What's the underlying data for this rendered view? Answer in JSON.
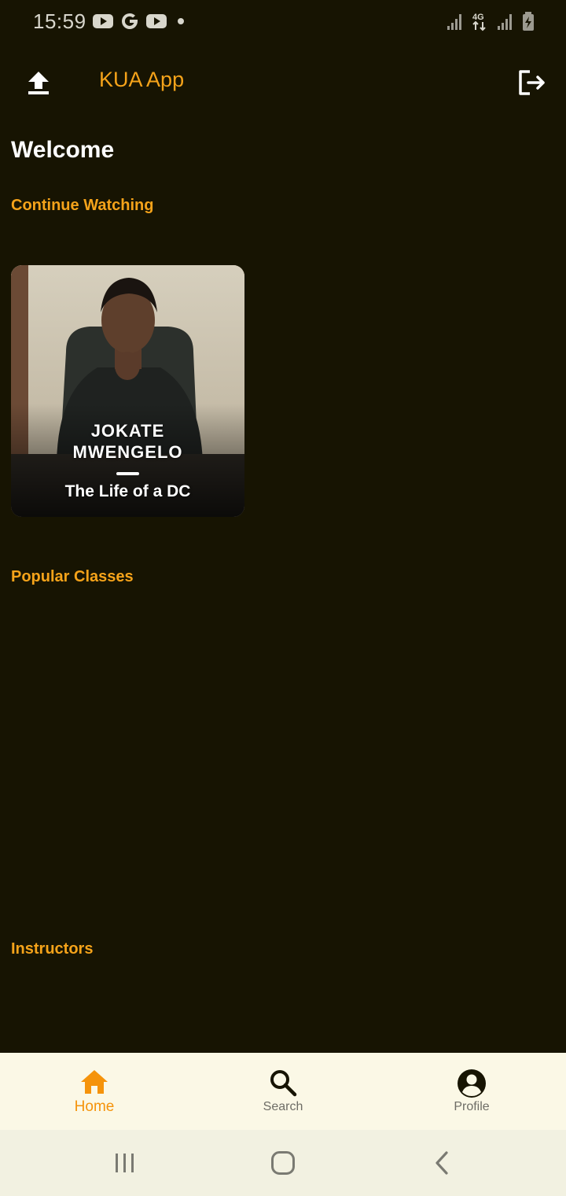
{
  "status_bar": {
    "time": "15:59",
    "left_icons": [
      "youtube-icon",
      "google-icon",
      "youtube-icon",
      "dot-icon"
    ],
    "right_icons": [
      "signal-icon",
      "4g-icon",
      "signal-icon",
      "battery-charging-icon"
    ],
    "network_label": "4G"
  },
  "app_bar": {
    "title": "KUA App",
    "left_icon": "upload-icon",
    "right_icon": "logout-icon"
  },
  "main": {
    "welcome": "Welcome",
    "continue_watching": {
      "title": "Continue Watching",
      "cards": [
        {
          "name_line1": "JOKATE",
          "name_line2": "MWENGELO",
          "subtitle": "The Life of a DC"
        }
      ]
    },
    "popular_classes": {
      "title": "Popular Classes"
    },
    "instructors": {
      "title": "Instructors"
    }
  },
  "bottom_nav": {
    "items": [
      {
        "label": "Home",
        "icon": "home-icon",
        "active": true
      },
      {
        "label": "Search",
        "icon": "search-icon",
        "active": false
      },
      {
        "label": "Profile",
        "icon": "profile-icon",
        "active": false
      }
    ]
  },
  "system_nav": [
    "recents-icon",
    "home-circle-icon",
    "back-icon"
  ],
  "colors": {
    "background": "#171402",
    "accent": "#f5a31a",
    "nav_background": "#fbf8e6",
    "active_nav": "#f5930b"
  }
}
